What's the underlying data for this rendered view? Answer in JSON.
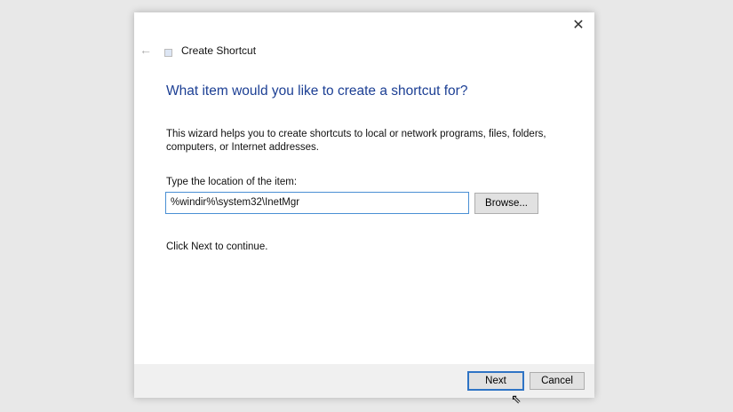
{
  "window": {
    "title": "Create Shortcut"
  },
  "heading": "What item would you like to create a shortcut for?",
  "description": "This wizard helps you to create shortcuts to local or network programs, files, folders, computers, or Internet addresses.",
  "location_label": "Type the location of the item:",
  "location_value": "%windir%\\system32\\InetMgr",
  "browse_label": "Browse...",
  "continue_text": "Click Next to continue.",
  "next_label": "Next",
  "cancel_label": "Cancel",
  "icons": {
    "back": "←",
    "close": "✕",
    "cursor": "⇖"
  }
}
